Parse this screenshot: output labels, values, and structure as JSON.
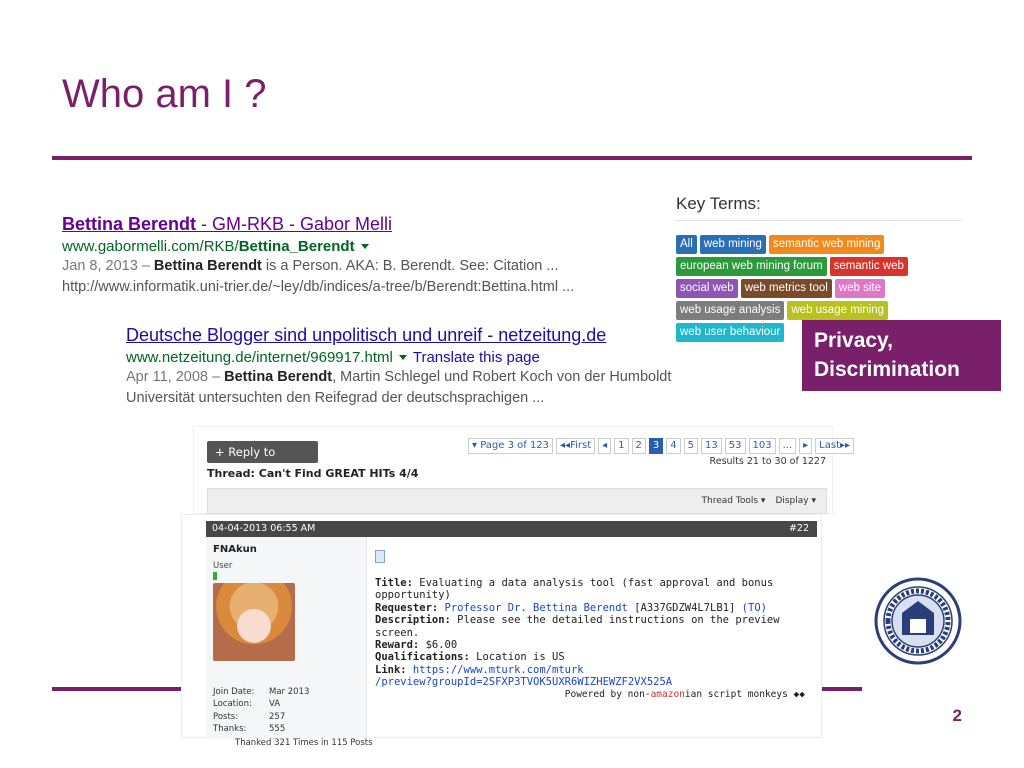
{
  "slide": {
    "title": "Who am I ?",
    "page_number": "2"
  },
  "search_results": [
    {
      "title_bold": "Bettina Berendt",
      "title_rest": " - GM-RKB - Gabor Melli",
      "url_plain": "www.gabormelli.com/RKB/",
      "url_bold": "Bettina_Berendt",
      "translate": "",
      "snippet_date": "Jan 8, 2013 – ",
      "snippet_bold": "Bettina Berendt",
      "snippet_rest": " is a Person. AKA: B. Berendt. See: Citation ...",
      "snippet_line2": "http://www.informatik.uni-trier.de/~ley/db/indices/a-tree/b/Berendt:Bettina.html ..."
    },
    {
      "title_bold": "",
      "title_rest": "Deutsche Blogger sind unpolitisch und unreif - netzeitung.de",
      "url_plain": "www.netzeitung.de/internet/969917.html",
      "url_bold": "",
      "translate": "Translate this page",
      "snippet_date": "Apr 11, 2008 – ",
      "snippet_bold": "Bettina Berendt",
      "snippet_rest": ", Martin Schlegel und Robert Koch von der Humboldt",
      "snippet_line2": "Universität untersuchten den Reifegrad der deutschsprachigen ..."
    }
  ],
  "key_terms": {
    "heading": "Key Terms:",
    "tags": [
      {
        "label": "All",
        "color": "#2a6fb5"
      },
      {
        "label": "web mining",
        "color": "#2a6fb5"
      },
      {
        "label": "semantic web mining",
        "color": "#f08a1c"
      },
      {
        "label": "european web mining forum",
        "color": "#2b9a3a"
      },
      {
        "label": "semantic web",
        "color": "#d9342b"
      },
      {
        "label": "social web",
        "color": "#8e55b5"
      },
      {
        "label": "web metrics tool",
        "color": "#7a4a2a"
      },
      {
        "label": "web site",
        "color": "#e077c6"
      },
      {
        "label": "web usage analysis",
        "color": "#7d7d7d"
      },
      {
        "label": "web usage mining",
        "color": "#b8c21c"
      },
      {
        "label": "web user behaviour",
        "color": "#1fb7c9"
      }
    ]
  },
  "callout": {
    "line1": "Privacy,",
    "line2": "Discrimination"
  },
  "forum": {
    "reply_button": "+ Reply to Thread",
    "thread_title": "Thread: Can't Find GREAT HITs 4/4",
    "pager": [
      {
        "label": "▾ Page 3 of 123",
        "current": false
      },
      {
        "label": "◂◂First",
        "current": false
      },
      {
        "label": "◂",
        "current": false
      },
      {
        "label": "1",
        "current": false
      },
      {
        "label": "2",
        "current": false
      },
      {
        "label": "3",
        "current": true
      },
      {
        "label": "4",
        "current": false
      },
      {
        "label": "5",
        "current": false
      },
      {
        "label": "13",
        "current": false
      },
      {
        "label": "53",
        "current": false
      },
      {
        "label": "103",
        "current": false
      },
      {
        "label": "...",
        "current": false
      },
      {
        "label": "▸",
        "current": false
      },
      {
        "label": "Last▸▸",
        "current": false
      }
    ],
    "results_count": "Results 21 to 30 of 1227",
    "thread_tools": "Thread Tools ▾",
    "display": "Display ▾",
    "post": {
      "date": "04-04-2013 06:55 AM",
      "number": "#22",
      "username": "FNAkun",
      "role": "User",
      "stats": [
        {
          "key": "Join Date:",
          "value": "Mar 2013"
        },
        {
          "key": "Location:",
          "value": "VA"
        },
        {
          "key": "Posts:",
          "value": "257"
        },
        {
          "key": "Thanks:",
          "value": "555"
        }
      ],
      "thanked": "Thanked 321 Times in 115 Posts",
      "title_label": "Title:",
      "title_value": " Evaluating a data analysis tool (fast approval and bonus opportunity)",
      "requester_label": "Requester:",
      "requester_name": " Professor Dr. Bettina Berendt",
      "requester_id": " [A337GDZW4L7LB1] ",
      "requester_to": "(TO)",
      "description_label": "Description:",
      "description_value": " Please see the detailed instructions on the preview screen.",
      "reward_label": "Reward:",
      "reward_value": " $6.00",
      "qualifications_label": "Qualifications:",
      "qualifications_value": " Location is US",
      "link_label": "Link:",
      "link_line1": " https://www.mturk.com/mturk",
      "link_line2": "/preview?groupId=2SFXP3TVOK5UXR6WIZHEWZF2VX525A",
      "powered_pre": "Powered by non-",
      "powered_amz": "amazon",
      "powered_post": "ian script monkeys ◆◆"
    }
  },
  "colors": {
    "accent": "#7a1f6a"
  }
}
